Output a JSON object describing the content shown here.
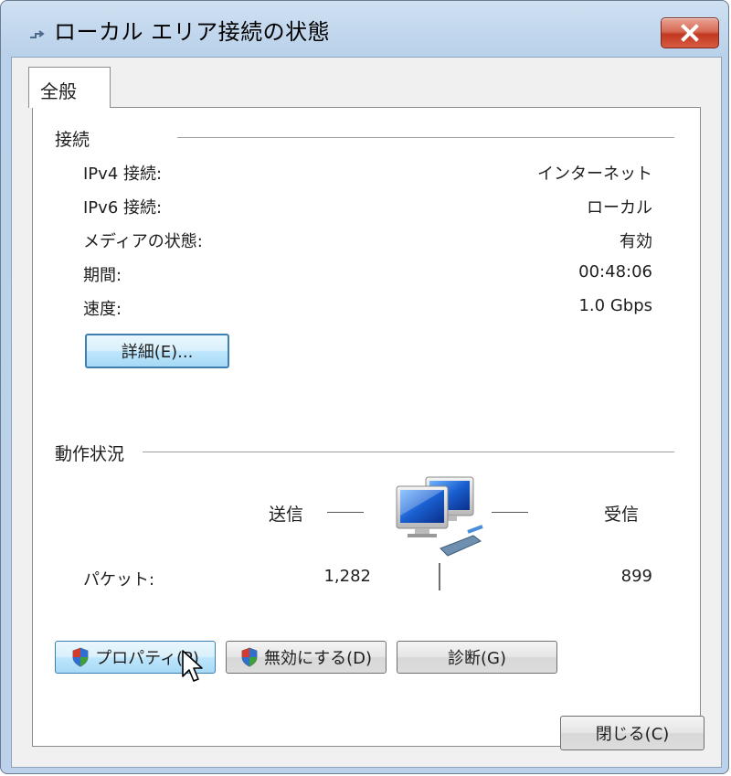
{
  "window": {
    "title": "ローカル エリア接続の状態"
  },
  "tabs": [
    {
      "label": "全般"
    }
  ],
  "connection": {
    "group_title": "接続",
    "rows": [
      {
        "label": "IPv4 接続:",
        "value": "インターネット"
      },
      {
        "label": "IPv6 接続:",
        "value": "ローカル"
      },
      {
        "label": "メディアの状態:",
        "value": "有効"
      },
      {
        "label": "期間:",
        "value": "00:48:06"
      },
      {
        "label": "速度:",
        "value": "1.0 Gbps"
      }
    ],
    "details_button": "詳細(E)..."
  },
  "activity": {
    "group_title": "動作状況",
    "sent_label": "送信",
    "received_label": "受信",
    "packets_label": "パケット:",
    "packets_sent": "1,282",
    "packets_received": "899"
  },
  "buttons": {
    "properties": "プロパティ(P)",
    "disable": "無効にする(D)",
    "diagnose": "診断(G)",
    "close": "閉じる(C)"
  },
  "icons": {
    "title": "network-icon",
    "shield": "uac-shield-icon",
    "connection": "network-computers-icon",
    "close": "close-icon",
    "cursor": "mouse-pointer-icon"
  },
  "colors": {
    "title_bar": "#b9d1ea",
    "close_button": "#c2381f",
    "focus_border": "#3c7fb1"
  }
}
